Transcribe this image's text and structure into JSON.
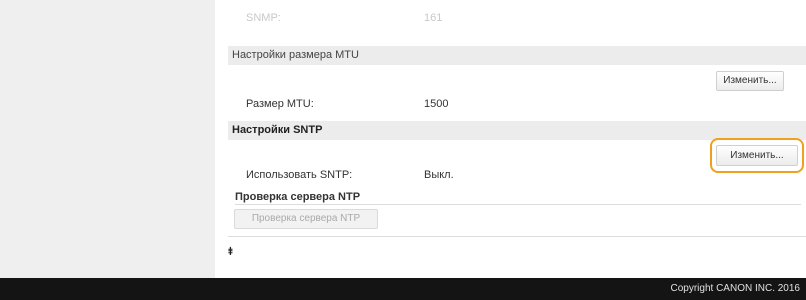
{
  "partial_row": {
    "label": "SNMP:",
    "value": "161"
  },
  "mtu_section": {
    "title": "Настройки размера MTU",
    "edit_label": "Изменить...",
    "field_label": "Размер MTU:",
    "field_value": "1500"
  },
  "sntp_section": {
    "title": "Настройки SNTP",
    "edit_label": "Изменить...",
    "field_label": "Использовать SNTP:",
    "field_value": "Выкл."
  },
  "ntp_check": {
    "heading": "Проверка сервера NTP",
    "button_label": "Проверка сервера NTP"
  },
  "top_link": {
    "icon": "arrow-to-top-icon",
    "symbol": "⯒"
  },
  "footer": {
    "copyright": "Copyright CANON INC. 2016"
  },
  "colors": {
    "highlight": "#f0a020",
    "footer_bg": "#141414",
    "sidebar_bg": "#efefef",
    "section_bg": "#ececec"
  }
}
